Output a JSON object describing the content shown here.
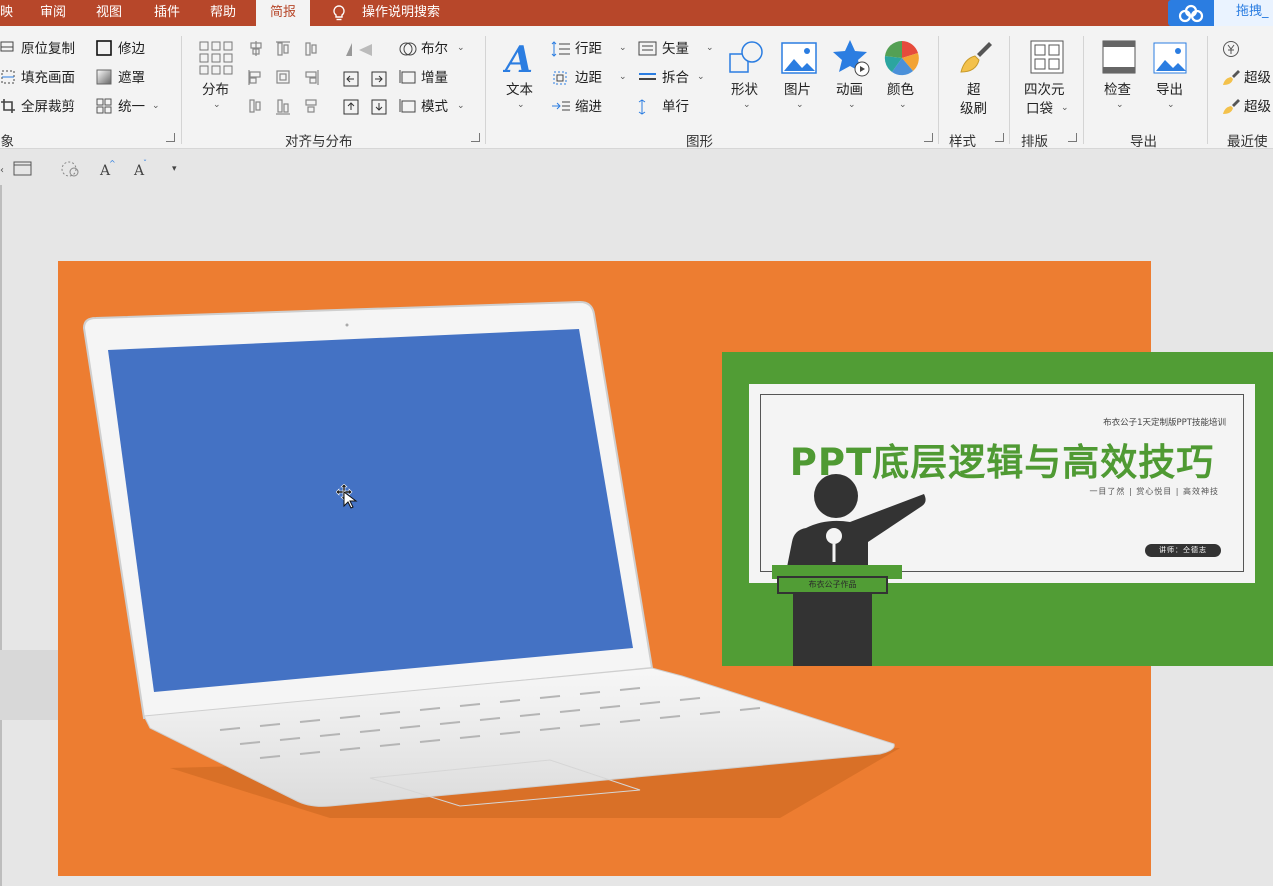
{
  "menu": {
    "tabs": [
      "映",
      "审阅",
      "视图",
      "插件",
      "帮助",
      "简报"
    ],
    "active_tab": "简报",
    "tell_me": "操作说明搜索",
    "login": "拖拽_"
  },
  "ribbon": {
    "object_group": {
      "label": "对象",
      "items": [
        "原位复制",
        "填充画面",
        "全屏裁剪",
        "修边",
        "遮罩",
        "统一"
      ]
    },
    "align_group": {
      "label": "对齐与分布",
      "distribute": "分布",
      "items": [
        "布尔",
        "增量",
        "模式"
      ]
    },
    "shape_group": {
      "label": "图形",
      "text": "文本",
      "items": [
        "行距",
        "边距",
        "缩进",
        "矢量",
        "拆合",
        "单行"
      ],
      "big": [
        "形状",
        "图片",
        "动画",
        "颜色"
      ]
    },
    "style_group": {
      "label": "样式",
      "super_brush_1": "超",
      "super_brush_2": "级刷"
    },
    "layout_group": {
      "label": "排版",
      "pocket_1": "四次元",
      "pocket_2": "口袋"
    },
    "export_group": {
      "label": "导出",
      "check": "检查",
      "export": "导出"
    },
    "recent_group": {
      "label": "最近使",
      "items": [
        "超级",
        "超级"
      ]
    }
  },
  "slide": {
    "card_subtitle": "布衣公子1天定制版PPT技能培训",
    "card_title": "PPT底层逻辑与高效技巧",
    "card_tagline": "一目了然 | 赏心悦目 | 高效神技",
    "lecturer_badge": "讲师：仝德志",
    "podium_sign": "布衣公子作品"
  },
  "colors": {
    "menu_bg": "#b7472a",
    "slide_bg": "#ed7d31",
    "laptop_screen": "#4472c4",
    "card_green": "#519d35"
  }
}
